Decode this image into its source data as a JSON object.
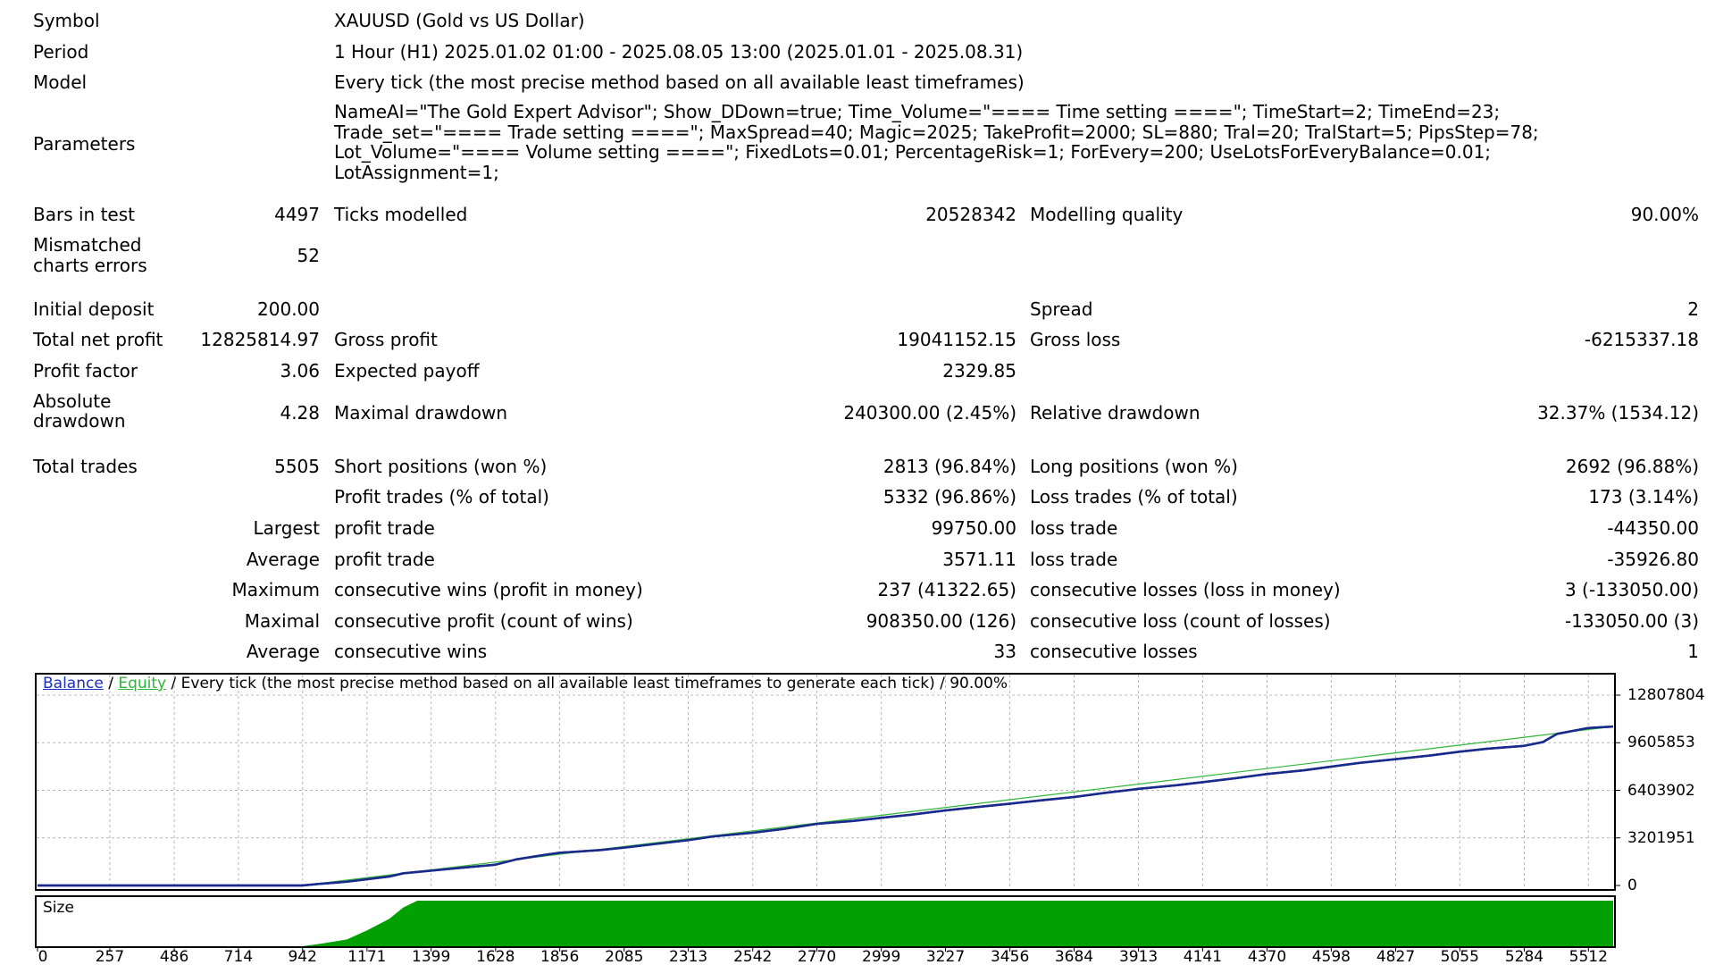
{
  "report": {
    "symbol_label": "Symbol",
    "symbol_value": "XAUUSD (Gold vs US Dollar)",
    "period_label": "Period",
    "period_value": "1 Hour (H1) 2025.01.02 01:00 - 2025.08.05 13:00 (2025.01.01 - 2025.08.31)",
    "model_label": "Model",
    "model_value": "Every tick (the most precise method based on all available least timeframes)",
    "parameters_label": "Parameters",
    "parameters_lines": [
      "NameAI=\"The Gold Expert Advisor\"; Show_DDown=true; Time_Volume=\"==== Time setting ====\"; TimeStart=2; TimeEnd=23;",
      "Trade_set=\"==== Trade setting ====\"; MaxSpread=40; Magic=2025; TakeProfit=2000; SL=880; Tral=20; TralStart=5; PipsStep=78;",
      "Lot_Volume=\"==== Volume setting ====\"; FixedLots=0.01; PercentageRisk=1; ForEvery=200; UseLotsForEveryBalance=0.01;",
      "LotAssignment=1;"
    ],
    "bars_label": "Bars in test",
    "bars_value": "4497",
    "ticks_label": "Ticks modelled",
    "ticks_value": "20528342",
    "quality_label": "Modelling quality",
    "quality_value": "90.00%",
    "mismatch_label_1": "Mismatched",
    "mismatch_label_2": "charts errors",
    "mismatch_value": "52",
    "deposit_label": "Initial deposit",
    "deposit_value": "200.00",
    "spread_label": "Spread",
    "spread_value": "2",
    "net_profit_label": "Total net profit",
    "net_profit_value": "12825814.97",
    "gross_profit_label": "Gross profit",
    "gross_profit_value": "19041152.15",
    "gross_loss_label": "Gross loss",
    "gross_loss_value": "-6215337.18",
    "profit_factor_label": "Profit factor",
    "profit_factor_value": "3.06",
    "expected_payoff_label": "Expected payoff",
    "expected_payoff_value": "2329.85",
    "abs_dd_label_1": "Absolute",
    "abs_dd_label_2": "drawdown",
    "abs_dd_value": "4.28",
    "max_dd_label": "Maximal drawdown",
    "max_dd_value": "240300.00 (2.45%)",
    "rel_dd_label": "Relative drawdown",
    "rel_dd_value": "32.37% (1534.12)",
    "total_trades_label": "Total trades",
    "total_trades_value": "5505",
    "short_label": "Short positions (won %)",
    "short_value": "2813 (96.84%)",
    "long_label": "Long positions (won %)",
    "long_value": "2692 (96.88%)",
    "profit_trades_label": "Profit trades (% of total)",
    "profit_trades_value": "5332 (96.86%)",
    "loss_trades_label": "Loss trades (% of total)",
    "loss_trades_value": "173 (3.14%)",
    "largest_label": "Largest",
    "largest_profit_label": "profit trade",
    "largest_profit_value": "99750.00",
    "largest_loss_label": "loss trade",
    "largest_loss_value": "-44350.00",
    "average_label": "Average",
    "average_profit_label": "profit trade",
    "average_profit_value": "3571.11",
    "average_loss_label": "loss trade",
    "average_loss_value": "-35926.80",
    "maximum_label": "Maximum",
    "max_cons_wins_label": "consecutive wins (profit in money)",
    "max_cons_wins_value": "237 (41322.65)",
    "max_cons_losses_label": "consecutive losses (loss in money)",
    "max_cons_losses_value": "3 (-133050.00)",
    "maximal_label": "Maximal",
    "maximal_profit_label": "consecutive profit (count of wins)",
    "maximal_profit_value": "908350.00 (126)",
    "maximal_loss_label": "consecutive loss (count of losses)",
    "maximal_loss_value": "-133050.00 (3)",
    "avg_cons_label": "Average",
    "avg_cons_wins_label": "consecutive wins",
    "avg_cons_wins_value": "33",
    "avg_cons_losses_label": "consecutive losses",
    "avg_cons_losses_value": "1"
  },
  "chart_title": {
    "balance": "Balance",
    "sep1": " / ",
    "equity": "Equity",
    "rest": " / Every tick (the most precise method based on all available least timeframes to generate each tick) / 90.00%"
  },
  "size_label": "Size",
  "chart_data": {
    "type": "line",
    "series": [
      {
        "name": "Balance",
        "color": "#1a2a8c",
        "x": [
          0,
          200,
          400,
          600,
          800,
          942,
          1000,
          1100,
          1171,
          1250,
          1300,
          1399,
          1500,
          1628,
          1700,
          1800,
          1856,
          2000,
          2085,
          2200,
          2313,
          2400,
          2542,
          2650,
          2770,
          2900,
          2999,
          3100,
          3227,
          3350,
          3456,
          3550,
          3684,
          3800,
          3913,
          4050,
          4141,
          4250,
          4370,
          4500,
          4598,
          4700,
          4827,
          4950,
          5055,
          5150,
          5284,
          5350,
          5400,
          5512,
          5600
        ],
        "y": [
          200,
          200,
          200,
          200,
          200,
          200,
          100000,
          250000,
          420000,
          600000,
          820000,
          1000000,
          1180000,
          1400000,
          1750000,
          2050000,
          2200000,
          2380000,
          2550000,
          2800000,
          3050000,
          3300000,
          3550000,
          3800000,
          4150000,
          4350000,
          4550000,
          4750000,
          5050000,
          5300000,
          5500000,
          5700000,
          5950000,
          6250000,
          6500000,
          6750000,
          6950000,
          7200000,
          7500000,
          7750000,
          8000000,
          8250000,
          8500000,
          8750000,
          9000000,
          9200000,
          9400000,
          9650000,
          10200000,
          10600000,
          10700000
        ]
      },
      {
        "name": "Equity",
        "color": "#2fb53a",
        "x": [
          0,
          942,
          5600
        ],
        "y": [
          200,
          200,
          10700000
        ]
      }
    ],
    "size_series": {
      "x": [
        0,
        942,
        1000,
        1100,
        1171,
        1250,
        1300,
        1350,
        5600
      ],
      "y": [
        0,
        0,
        0.05,
        0.15,
        0.35,
        0.6,
        0.85,
        1,
        1
      ]
    },
    "yticks": [
      "12807804",
      "9605853",
      "6403902",
      "3201951",
      "0"
    ],
    "ytick_values": [
      12807804,
      9605853,
      6403902,
      3201951,
      0
    ],
    "xticks": [
      "0",
      "257",
      "486",
      "714",
      "942",
      "1171",
      "1399",
      "1628",
      "1856",
      "2085",
      "2313",
      "2542",
      "2770",
      "2999",
      "3227",
      "3456",
      "3684",
      "3913",
      "4141",
      "4370",
      "4598",
      "4827",
      "5055",
      "5284",
      "5512"
    ],
    "xtick_values": [
      0,
      257,
      486,
      714,
      942,
      1171,
      1399,
      1628,
      1856,
      2085,
      2313,
      2542,
      2770,
      2999,
      3227,
      3456,
      3684,
      3913,
      4141,
      4370,
      4598,
      4827,
      5055,
      5284,
      5512
    ],
    "xlim": [
      0,
      5600
    ],
    "ylim": [
      0,
      12807804
    ],
    "grid": true,
    "balance_color": "#1a2a8c",
    "size_color": "#00a000"
  }
}
